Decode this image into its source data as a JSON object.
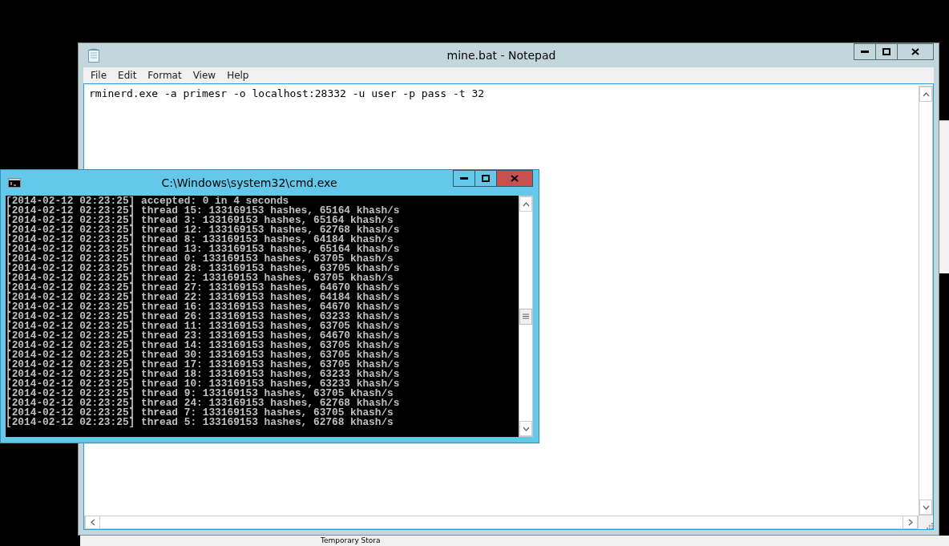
{
  "notepad": {
    "title": "mine.bat - Notepad",
    "menu": [
      "File",
      "Edit",
      "Format",
      "View",
      "Help"
    ],
    "content": "rminerd.exe -a primesr -o localhost:28332 -u user -p pass -t 32"
  },
  "console": {
    "title": "C:\\Windows\\system32\\cmd.exe",
    "lines": [
      "[2014-02-12 02:23:25] accepted: 0 in 4 seconds",
      "[2014-02-12 02:23:25] thread 15: 133169153 hashes, 65164 khash/s",
      "[2014-02-12 02:23:25] thread 3: 133169153 hashes, 65164 khash/s",
      "[2014-02-12 02:23:25] thread 12: 133169153 hashes, 62768 khash/s",
      "[2014-02-12 02:23:25] thread 8: 133169153 hashes, 64184 khash/s",
      "[2014-02-12 02:23:25] thread 13: 133169153 hashes, 65164 khash/s",
      "[2014-02-12 02:23:25] thread 0: 133169153 hashes, 63705 khash/s",
      "[2014-02-12 02:23:25] thread 28: 133169153 hashes, 63705 khash/s",
      "[2014-02-12 02:23:25] thread 2: 133169153 hashes, 63705 khash/s",
      "[2014-02-12 02:23:25] thread 27: 133169153 hashes, 64670 khash/s",
      "[2014-02-12 02:23:25] thread 22: 133169153 hashes, 64184 khash/s",
      "[2014-02-12 02:23:25] thread 16: 133169153 hashes, 64670 khash/s",
      "[2014-02-12 02:23:25] thread 26: 133169153 hashes, 63233 khash/s",
      "[2014-02-12 02:23:25] thread 11: 133169153 hashes, 63705 khash/s",
      "[2014-02-12 02:23:25] thread 23: 133169153 hashes, 64670 khash/s",
      "[2014-02-12 02:23:25] thread 14: 133169153 hashes, 63705 khash/s",
      "[2014-02-12 02:23:25] thread 30: 133169153 hashes, 63705 khash/s",
      "[2014-02-12 02:23:25] thread 17: 133169153 hashes, 63705 khash/s",
      "[2014-02-12 02:23:25] thread 18: 133169153 hashes, 63233 khash/s",
      "[2014-02-12 02:23:25] thread 10: 133169153 hashes, 63233 khash/s",
      "[2014-02-12 02:23:25] thread 9: 133169153 hashes, 63705 khash/s",
      "[2014-02-12 02:23:25] thread 24: 133169153 hashes, 62768 khash/s",
      "[2014-02-12 02:23:25] thread 7: 133169153 hashes, 63705 khash/s",
      "[2014-02-12 02:23:25] thread 5: 133169153 hashes, 62768 khash/s"
    ]
  },
  "background_window": {
    "label": "Temporary Stora"
  }
}
